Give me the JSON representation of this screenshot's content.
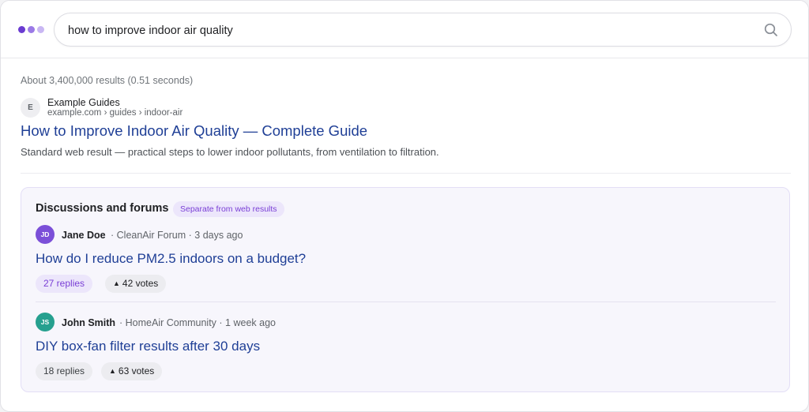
{
  "brand": {
    "dot_colors": [
      "#6a3bd1",
      "#9b7ae6",
      "#c9b7f3"
    ]
  },
  "search": {
    "query": "how to improve indoor air quality",
    "button_icon": "search-icon"
  },
  "results_meta": "About 3,400,000 results (0.51 seconds)",
  "web_result": {
    "favicon_letter": "E",
    "site_name": "Example Guides",
    "url": "example.com › guides › indoor-air",
    "title": "How to Improve Indoor Air Quality — Complete Guide",
    "snippet": "Standard web result — practical steps to lower indoor pollutants, from ventilation to filtration."
  },
  "discussions": {
    "title": "Discussions and forums",
    "badge": "Separate from web results",
    "threads": [
      {
        "initials": "JD",
        "avatar_color": "#7b4fd8",
        "author": "Jane Doe",
        "meta": "· CleanAir Forum · 3 days ago",
        "title": "How do I reduce PM2.5 indoors on a budget?",
        "replies": "27 replies",
        "votes": "42 votes"
      },
      {
        "initials": "JS",
        "avatar_color": "#26a08f",
        "author": "John Smith",
        "meta": "· HomeAir Community · 1 week ago",
        "title": "DIY box-fan filter results after 30 days",
        "replies": "18 replies",
        "votes": "63 votes"
      }
    ],
    "vote_icon": "upvote-icon"
  },
  "colors": {
    "link": "#1f3f96",
    "accent": "#7a3fd6",
    "panel_bg": "#f7f6fc"
  }
}
